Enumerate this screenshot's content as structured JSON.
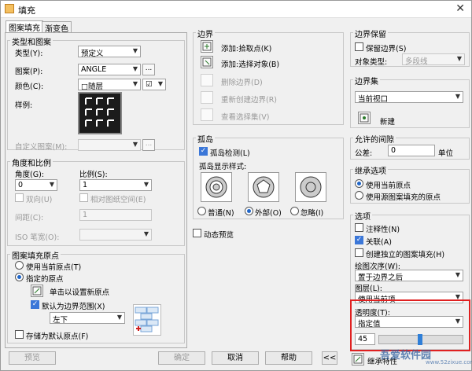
{
  "window": {
    "title": "填充",
    "close": "✕"
  },
  "tabs": [
    "图案填充",
    "渐变色"
  ],
  "type_pattern": {
    "title": "类型和图案",
    "type_label": "类型(Y):",
    "type_value": "预定义",
    "pattern_label": "图案(P):",
    "pattern_value": "ANGLE",
    "browse": "...",
    "color_label": "颜色(C):",
    "color_value": "□随层",
    "color2_value": "☑",
    "sample_label": "样例:",
    "custom_label": "自定义图案(M):"
  },
  "angle_scale": {
    "title": "角度和比例",
    "angle_label": "角度(G):",
    "angle_value": "0",
    "scale_label": "比例(S):",
    "scale_value": "1",
    "double_label": "双向(U)",
    "relative_label": "相对图纸空间(E)",
    "spacing_label": "间距(C):",
    "spacing_value": "1",
    "iso_label": "ISO 笔宽(O):"
  },
  "origin": {
    "title": "图案填充原点",
    "current_label": "使用当前原点(T)",
    "specified_label": "指定的原点",
    "click_set_label": "单击以设置新原点",
    "default_extent_label": "默认为边界范围(X)",
    "extent_value": "左下",
    "store_default_label": "存储为默认原点(F)"
  },
  "boundaries": {
    "title": "边界",
    "pick_points": "添加:拾取点(K)",
    "select_objects": "添加:选择对象(B)",
    "remove": "删除边界(D)",
    "recreate": "重新创建边界(R)",
    "view_selection": "查看选择集(V)"
  },
  "islands": {
    "title": "孤岛",
    "detect_label": "孤岛检测(L)",
    "style_label": "孤岛显示样式:",
    "normal": "普通(N)",
    "outer": "外部(O)",
    "ignore": "忽略(I)"
  },
  "preview_dyn": "动态预览",
  "boundary_retention": {
    "title": "边界保留",
    "retain_label": "保留边界(S)",
    "object_type_label": "对象类型:",
    "object_type_value": "多段线"
  },
  "boundary_set": {
    "title": "边界集",
    "value": "当前视口",
    "new_label": "新建"
  },
  "gap": {
    "title": "允许的间隙",
    "tolerance_label": "公差:",
    "tolerance_value": "0",
    "unit": "单位"
  },
  "inherit": {
    "title": "继承选项",
    "use_current": "使用当前原点",
    "use_source": "使用源图案填充的原点"
  },
  "options": {
    "title": "选项",
    "annotative": "注释性(N)",
    "associative": "关联(A)",
    "separate": "创建独立的图案填充(H)",
    "draw_order_label": "绘图次序(W):",
    "draw_order_value": "置于边界之后",
    "layer_label": "图层(L):",
    "layer_value": "使用当前项",
    "transparency_label": "透明度(T):",
    "transparency_mode": "指定值",
    "transparency_value": "45"
  },
  "footer": {
    "preview": "预览",
    "ok": "确定",
    "cancel": "取消",
    "help": "帮助",
    "expand": "<<",
    "inherit_btn": "继承特性"
  },
  "watermark": {
    "brand": "吾爱软件园",
    "url": "www.52zixue.com"
  }
}
